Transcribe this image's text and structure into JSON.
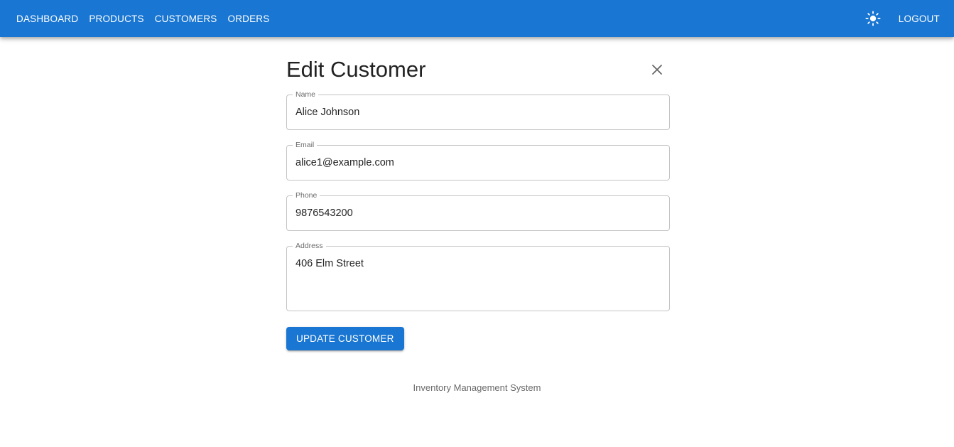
{
  "appbar": {
    "nav": [
      "DASHBOARD",
      "PRODUCTS",
      "CUSTOMERS",
      "ORDERS"
    ],
    "theme_icon": "sun-icon",
    "logout_label": "LOGOUT",
    "color": "#1976d2"
  },
  "form": {
    "title": "Edit Customer",
    "close_icon": "close-icon",
    "fields": [
      {
        "label": "Name",
        "value": "Alice Johnson"
      },
      {
        "label": "Email",
        "value": "alice1@example.com"
      },
      {
        "label": "Phone",
        "value": "9876543200"
      },
      {
        "label": "Address",
        "value": "406 Elm Street"
      }
    ],
    "submit_label": "UPDATE CUSTOMER"
  },
  "footer": {
    "text": "Inventory Management System"
  }
}
